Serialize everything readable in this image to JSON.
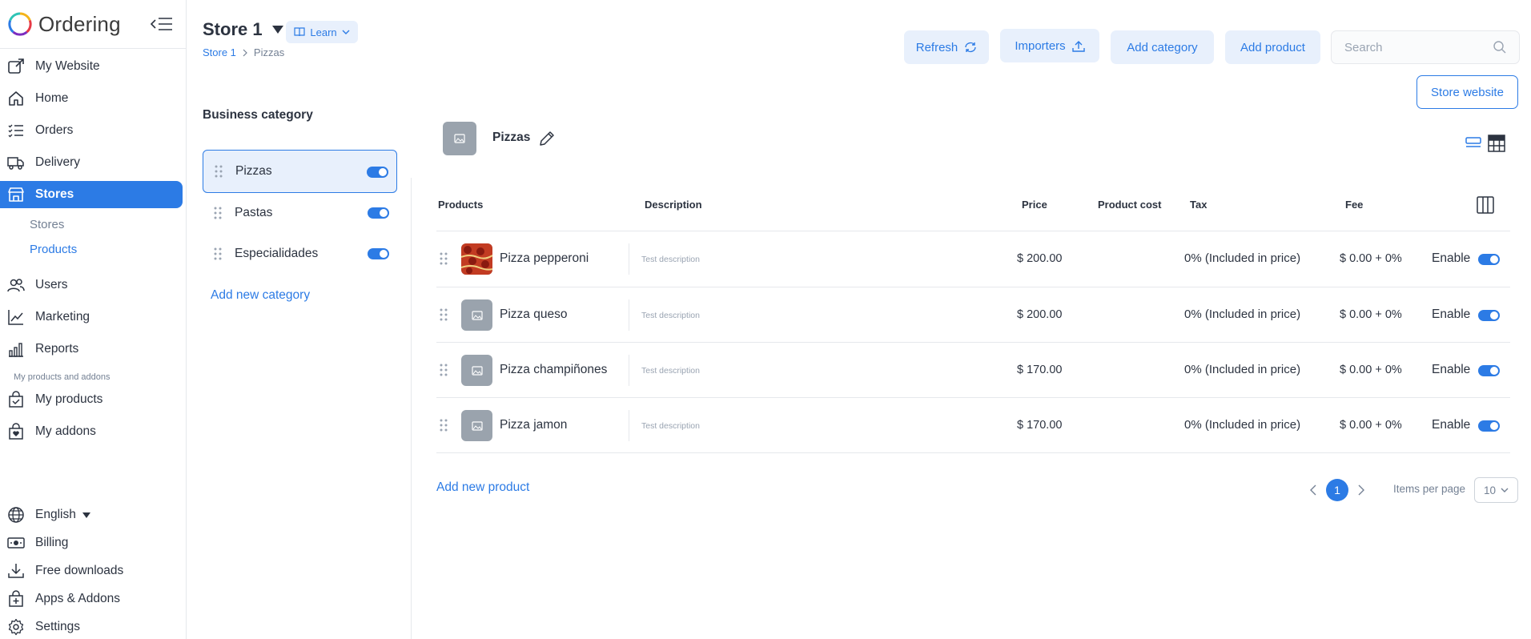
{
  "app": {
    "name": "Ordering"
  },
  "sidebar": {
    "items": [
      {
        "label": "My Website",
        "icon": "external-link-icon"
      },
      {
        "label": "Home",
        "icon": "home-icon"
      },
      {
        "label": "Orders",
        "icon": "list-icon"
      },
      {
        "label": "Delivery",
        "icon": "truck-icon"
      },
      {
        "label": "Stores",
        "icon": "store-icon",
        "active": true
      },
      {
        "label": "Users",
        "icon": "users-icon"
      },
      {
        "label": "Marketing",
        "icon": "chart-line-icon"
      },
      {
        "label": "Reports",
        "icon": "bar-chart-icon"
      }
    ],
    "sub_items": [
      {
        "label": "Stores"
      },
      {
        "label": "Products",
        "active": true
      }
    ],
    "section_label": "My products and addons",
    "products_items": [
      {
        "label": "My products",
        "icon": "bag-check-icon"
      },
      {
        "label": "My addons",
        "icon": "bag-heart-icon"
      }
    ],
    "footer_items": [
      {
        "label": "English",
        "icon": "globe-icon"
      },
      {
        "label": "Billing",
        "icon": "cash-icon"
      },
      {
        "label": "Free downloads",
        "icon": "download-icon"
      },
      {
        "label": "Apps & Addons",
        "icon": "bag-plus-icon"
      },
      {
        "label": "Settings",
        "icon": "gear-icon"
      }
    ]
  },
  "header": {
    "store_title": "Store 1",
    "learn_label": "Learn",
    "breadcrumb": [
      "Store 1",
      "Pizzas"
    ],
    "buttons": {
      "refresh": "Refresh",
      "importers": "Importers",
      "add_category": "Add category",
      "add_product": "Add product",
      "store_website": "Store website"
    },
    "search_placeholder": "Search"
  },
  "categories": {
    "heading": "Business category",
    "items": [
      {
        "label": "Pizzas",
        "enabled": true,
        "active": true
      },
      {
        "label": "Pastas",
        "enabled": true
      },
      {
        "label": "Especialidades",
        "enabled": true
      }
    ],
    "add_label": "Add new category"
  },
  "products": {
    "category_name": "Pizzas",
    "columns": [
      "Products",
      "Description",
      "Price",
      "Product cost",
      "Tax",
      "Fee"
    ],
    "rows": [
      {
        "name": "Pizza pepperoni",
        "description": "Test description",
        "price": "$ 200.00",
        "tax": "0% (Included in price)",
        "fee": "$ 0.00 + 0%",
        "status": "Enable",
        "has_photo": true
      },
      {
        "name": "Pizza queso",
        "description": "Test description",
        "price": "$ 200.00",
        "tax": "0% (Included in price)",
        "fee": "$ 0.00 + 0%",
        "status": "Enable"
      },
      {
        "name": "Pizza champiñones",
        "description": "Test description",
        "price": "$ 170.00",
        "tax": "0% (Included in price)",
        "fee": "$ 0.00 + 0%",
        "status": "Enable"
      },
      {
        "name": "Pizza jamon",
        "description": "Test description",
        "price": "$ 170.00",
        "tax": "0% (Included in price)",
        "fee": "$ 0.00 + 0%",
        "status": "Enable"
      }
    ],
    "add_label": "Add new product",
    "pagination": {
      "current_page": "1",
      "items_per_page_label": "Items per page",
      "items_per_page": "10"
    }
  },
  "colors": {
    "accent": "#2c7be5",
    "accent_light": "#e8f0fc",
    "text": "#2c3340",
    "muted": "#748194"
  }
}
